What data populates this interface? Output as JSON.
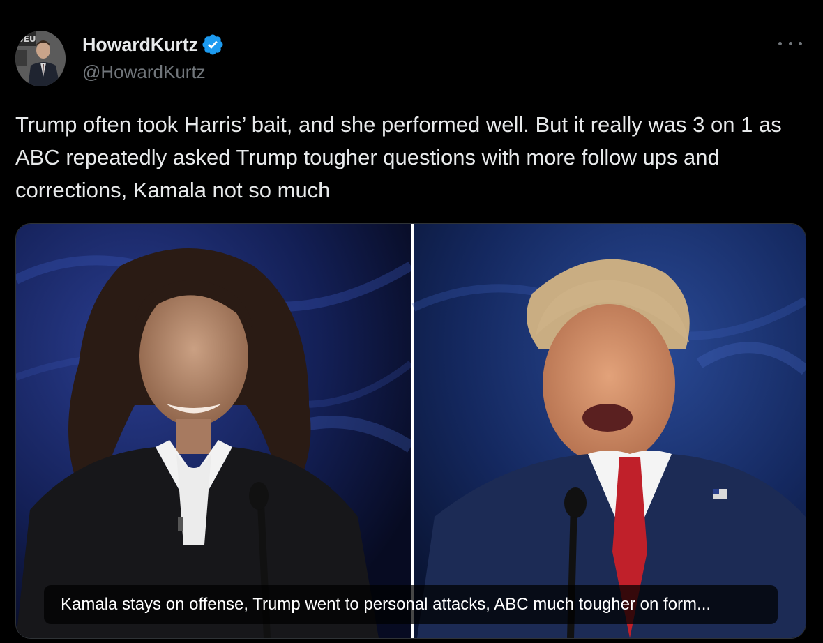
{
  "author": {
    "display_name": "HowardKurtz",
    "handle": "@HowardKurtz",
    "verified_icon": "verified-badge-icon",
    "avatar_icon": "profile-photo"
  },
  "tweet": {
    "text": "Trump often took Harris’ bait, and she performed well. But it really was 3 on 1 as ABC repeatedly asked Trump tougher questions with more follow ups and corrections, Kamala not so much"
  },
  "media": {
    "card_title": "Kamala stays on offense, Trump went to personal attacks, ABC much tougher on form..."
  },
  "colors": {
    "background": "#000000",
    "text_primary": "#e7e9ea",
    "text_secondary": "#71767b",
    "verified_blue": "#1d9bf0",
    "border": "#2f3336"
  }
}
